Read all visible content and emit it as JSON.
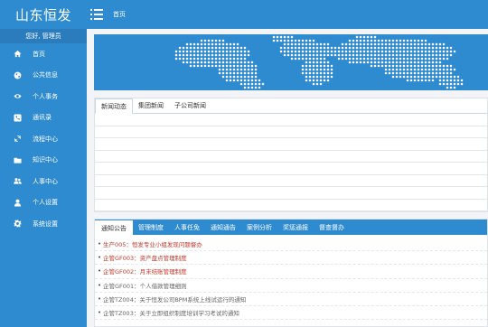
{
  "app": {
    "brand": "山东恒发",
    "greeting": "您好, 管理员"
  },
  "sidebar": {
    "items": [
      {
        "label": "首页",
        "icon": "home-icon"
      },
      {
        "label": "公共信息",
        "icon": "globe-icon"
      },
      {
        "label": "个人事务",
        "icon": "eye-icon"
      },
      {
        "label": "通讯录",
        "icon": "phone-icon"
      },
      {
        "label": "流程中心",
        "icon": "refresh-icon"
      },
      {
        "label": "知识中心",
        "icon": "folder-icon"
      },
      {
        "label": "人事中心",
        "icon": "users-icon"
      },
      {
        "label": "个人设置",
        "icon": "user-icon"
      },
      {
        "label": "系统设置",
        "icon": "gear-icon"
      }
    ]
  },
  "header": {
    "breadcrumb": "首页"
  },
  "news": {
    "tabs": [
      "新闻动态",
      "集团新闻",
      "子公司新闻"
    ],
    "active_tab": 0
  },
  "notice": {
    "tabs": [
      "通知公告",
      "管理制度",
      "人事任免",
      "通知通告",
      "案例分析",
      "奖惩通报",
      "督查督办"
    ],
    "active_tab": 0,
    "items": [
      {
        "text": "生产005：恒发专业小组发现问题督办",
        "color": "red"
      },
      {
        "text": "企管GF003：资产盘点管理制度",
        "color": "red"
      },
      {
        "text": "企管GF002：月末结账管理制度",
        "color": "red"
      },
      {
        "text": "企管GF001：个人借款管理细则",
        "color": "gray"
      },
      {
        "text": "企管TZ004：关于恒发公司BPM系统上线试运行的通知",
        "color": "gray"
      },
      {
        "text": "企管TZ003：关于立即组织制度培训学习考试的通知",
        "color": "gray"
      }
    ]
  },
  "colors": {
    "primary": "#2f8bcf",
    "red_text": "#c0392b"
  }
}
